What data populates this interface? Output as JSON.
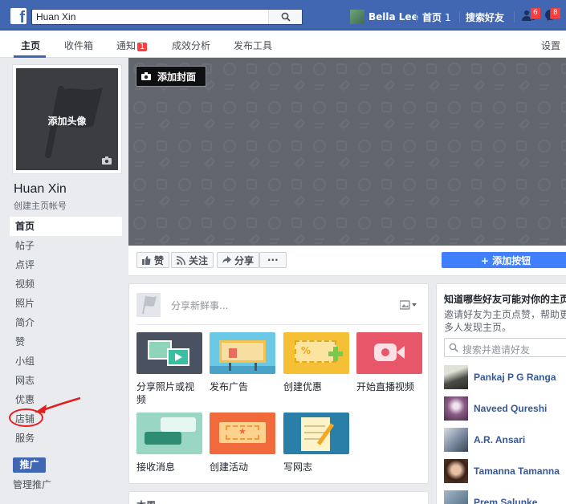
{
  "topbar": {
    "search_value": "Huan  Xin",
    "user_name": "Bella Lee",
    "home_label": "首页",
    "home_count": "1",
    "find_friends_label": "搜索好友",
    "friend_requests_badge": "6",
    "messages_badge": "8",
    "brand_color": "#4267b2"
  },
  "subnav": {
    "tabs": [
      {
        "label": "主页"
      },
      {
        "label": "收件箱"
      },
      {
        "label": "通知",
        "badge": "1"
      },
      {
        "label": "成效分析"
      },
      {
        "label": "发布工具"
      }
    ],
    "settings_label": "设置"
  },
  "profile": {
    "add_avatar_label": "添加头像",
    "page_name": "Huan Xin",
    "create_handle_label": "创建主页帐号"
  },
  "leftnav": {
    "items": [
      {
        "label": "首页"
      },
      {
        "label": "帖子"
      },
      {
        "label": "点评"
      },
      {
        "label": "视频"
      },
      {
        "label": "照片"
      },
      {
        "label": "简介"
      },
      {
        "label": "赞"
      },
      {
        "label": "小组"
      },
      {
        "label": "网志"
      },
      {
        "label": "优惠"
      },
      {
        "label": "店铺"
      },
      {
        "label": "服务"
      }
    ],
    "promote_label": "推广",
    "manage_promotions_label": "管理推广"
  },
  "cover": {
    "add_cover_label": "添加封面"
  },
  "actions": {
    "like_label": "赞",
    "follow_label": "关注",
    "share_label": "分享",
    "more_label": "···",
    "add_button_label": "+ 添加按钮"
  },
  "composer": {
    "placeholder": "分享新鲜事...",
    "tiles": [
      {
        "label": "分享照片或视频"
      },
      {
        "label": "发布广告"
      },
      {
        "label": "创建优惠"
      },
      {
        "label": "开始直播视频"
      },
      {
        "label": "接收消息"
      },
      {
        "label": "创建活动"
      },
      {
        "label": "写网志"
      }
    ]
  },
  "bottom_card": {
    "title": "本周"
  },
  "invite": {
    "title": "知道哪些好友可能对你的主页",
    "description": "邀请好友为主页点赞，帮助更多人发现主页。",
    "search_placeholder": "搜索并邀请好友",
    "friends": [
      {
        "name": "Pankaj P G Ranga"
      },
      {
        "name": "Naveed Qureshi"
      },
      {
        "name": "A.R. Ansari"
      },
      {
        "name": "Tamanna Tamanna"
      },
      {
        "name": "Prem Salunke"
      }
    ]
  }
}
